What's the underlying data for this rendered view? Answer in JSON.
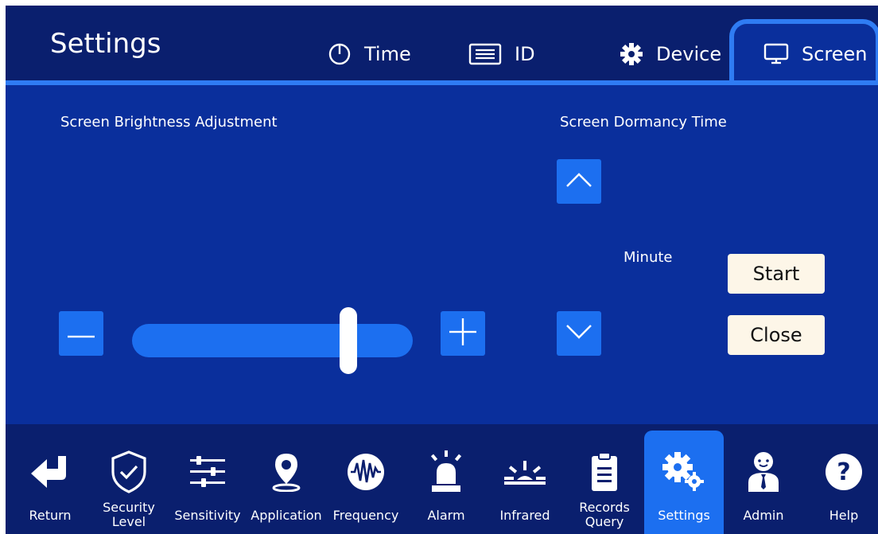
{
  "header": {
    "title": "Settings",
    "tabs": [
      {
        "label": "Time",
        "icon": "clock-icon"
      },
      {
        "label": "ID",
        "icon": "id-card-icon"
      },
      {
        "label": "Device",
        "icon": "gear-icon"
      },
      {
        "label": "Screen",
        "icon": "monitor-icon",
        "active": true
      }
    ]
  },
  "brightness": {
    "label": "Screen Brightness Adjustment",
    "level": 0.77
  },
  "dormancy": {
    "label": "Screen Dormancy Time",
    "unit": "Minute",
    "start_label": "Start",
    "close_label": "Close"
  },
  "nav": {
    "items": [
      {
        "label": "Return",
        "icon": "return-arrow-icon"
      },
      {
        "label": "Security Level",
        "line1": "Security",
        "line2": "Level",
        "icon": "shield-check-icon"
      },
      {
        "label": "Sensitivity",
        "icon": "sliders-icon"
      },
      {
        "label": "Application",
        "icon": "location-pin-icon"
      },
      {
        "label": "Frequency",
        "icon": "waveform-icon"
      },
      {
        "label": "Alarm",
        "icon": "siren-icon"
      },
      {
        "label": "Infrared",
        "icon": "infrared-icon"
      },
      {
        "label": "Records Query",
        "line1": "Records",
        "line2": "Query",
        "icon": "clipboard-icon"
      },
      {
        "label": "Settings",
        "icon": "gears-icon",
        "active": true
      },
      {
        "label": "Admin",
        "icon": "admin-user-icon"
      },
      {
        "label": "Help",
        "icon": "help-icon"
      }
    ]
  },
  "colors": {
    "header_bg": "#0a1f6e",
    "content_bg": "#0a2f9c",
    "accent": "#1c6ff0",
    "tab_border": "#2f7cf3",
    "button_cream": "#fdf6e8"
  }
}
